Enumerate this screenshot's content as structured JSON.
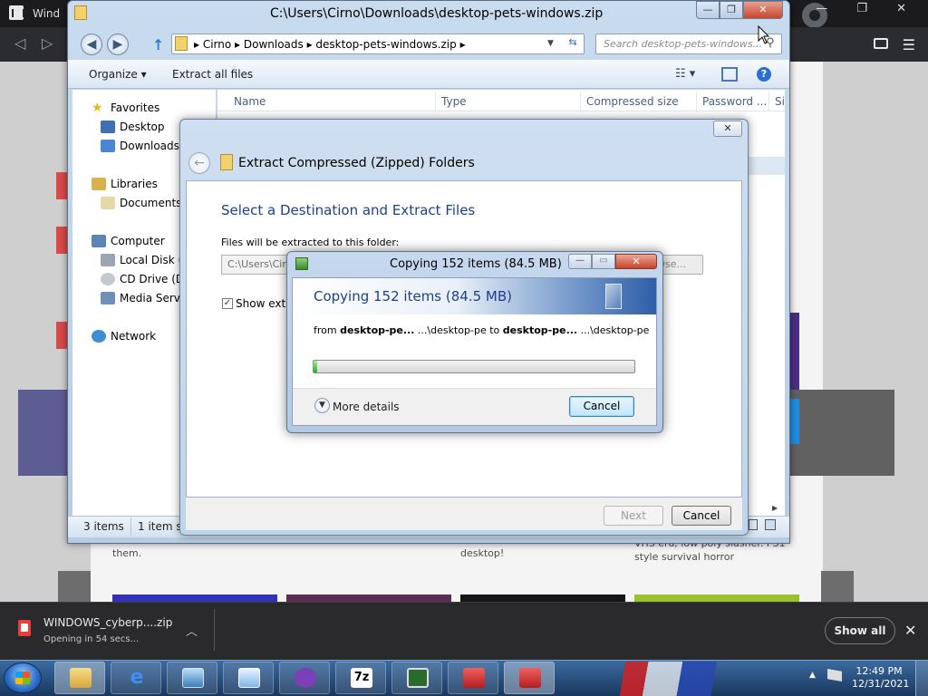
{
  "browser": {
    "tab_title": "Wind",
    "caption_buttons": "— ❐ ✕",
    "menu_icon": "menu-dots-icon"
  },
  "page": {
    "caption1": "them.",
    "caption2": "desktop!",
    "caption3": "VHS era, low poly slasher. PS1 style survival horror"
  },
  "download": {
    "file_name": "WINDOWS_cyberp....zip",
    "status": "Opening in 54 secs...",
    "show_all": "Show all"
  },
  "explorer": {
    "title": "C:\\Users\\Cirno\\Downloads\\desktop-pets-windows.zip",
    "breadcrumb": "▸  Cirno  ▸  Downloads  ▸  desktop-pets-windows.zip  ▸",
    "search_placeholder": "Search desktop-pets-windows...",
    "toolbar": {
      "organize": "Organize ▾",
      "extract_all": "Extract all files"
    },
    "nav": {
      "favorites": "Favorites",
      "desktop": "Desktop",
      "downloads": "Downloads",
      "libraries": "Libraries",
      "documents": "Documents",
      "computer": "Computer",
      "local_disk": "Local Disk (C",
      "cd_drive": "CD Drive (D:)",
      "media_server": "Media Server",
      "network": "Network"
    },
    "columns": [
      "Name",
      "Type",
      "Compressed size",
      "Password ...",
      "Si"
    ],
    "status": {
      "items": "3 items",
      "selected": "1 item se"
    }
  },
  "wizard": {
    "title": "Extract Compressed (Zipped) Folders",
    "heading": "Select a Destination and Extract Files",
    "label": "Files will be extracted to this folder:",
    "path_value": "C:\\Users\\Cirno",
    "browse": "wse...",
    "show_label": "Show extra",
    "show_checked": true,
    "next": "Next",
    "cancel": "Cancel"
  },
  "copy": {
    "title": "Copying 152 items (84.5 MB)",
    "heading": "Copying 152 items (84.5 MB)",
    "from_prefix": "from ",
    "from_bold": "desktop-pe...",
    "from_path": " ...\\desktop-pe",
    "to_word": " to ",
    "to_bold": "desktop-pe...",
    "to_path": " ...\\desktop-pe",
    "progress_fraction": 0.012,
    "more_details": "More details",
    "cancel": "Cancel"
  },
  "taskbar": {
    "clock_time": "12:49 PM",
    "clock_date": "12/31/2021",
    "apps": [
      "file-explorer-icon",
      "internet-explorer-icon",
      "photo-viewer-icon",
      "remote-desktop-icon",
      "brave-browser-icon",
      "7zip-icon",
      "task-manager-icon",
      "toolbox-icon",
      "toolbox-icon"
    ],
    "seven_zip_label": "7z"
  }
}
